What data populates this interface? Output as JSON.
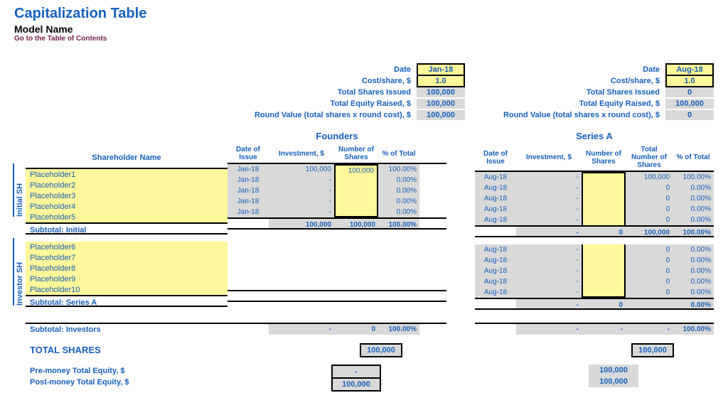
{
  "header": {
    "title": "Capitalization Table",
    "subtitle": "Model Name",
    "toc": "Go to the Table of Contents"
  },
  "summary": {
    "labels": {
      "date": "Date",
      "cost": "Cost/share, $",
      "shares": "Total Shares Issued",
      "equity": "Total Equity Raised, $",
      "roundval": "Round Value (total shares x round cost), $"
    },
    "founders": {
      "date": "Jan-18",
      "cost": "1.0",
      "shares": "100,000",
      "equity": "100,000",
      "roundval": "100,000"
    },
    "seriesA": {
      "date": "Aug-18",
      "cost": "1.0",
      "shares": "0",
      "equity": "100,000",
      "roundval": "0"
    }
  },
  "labels": {
    "shName": "Shareholder Name",
    "founders": "Founders",
    "seriesA": "Series A",
    "dateIssue": "Date of Issue",
    "investment": "Investment, $",
    "numShares": "Number of Shares",
    "totNumShares": "Total Number of Shares",
    "pctTotal": "% of Total",
    "initialSH": "Initial SH",
    "investorSH": "Investor SH",
    "subInitial": "Subtotal: Initial",
    "subSeriesA": "Subtotal: Series A",
    "subInvestors": "Subtotal: Investors",
    "totalShares": "TOTAL SHARES",
    "preMoney": "Pre-money Total Equity, $",
    "postMoney": "Post-money Total Equity, $"
  },
  "initial": [
    {
      "name": "Placeholder1",
      "f_date": "Jan-18",
      "f_inv": "100,000",
      "f_num": "100,000",
      "f_pct": "100.00%",
      "a_date": "Aug-18",
      "a_inv": "-",
      "a_num": "",
      "a_tot": "100,000",
      "a_pct": "100.00%"
    },
    {
      "name": "Placeholder2",
      "f_date": "Jan-18",
      "f_inv": "-",
      "f_num": "",
      "f_pct": "0.00%",
      "a_date": "Aug-18",
      "a_inv": "-",
      "a_num": "",
      "a_tot": "0",
      "a_pct": "0.00%"
    },
    {
      "name": "Placeholder3",
      "f_date": "Jan-18",
      "f_inv": "-",
      "f_num": "",
      "f_pct": "0.00%",
      "a_date": "Aug-18",
      "a_inv": "-",
      "a_num": "",
      "a_tot": "0",
      "a_pct": "0.00%"
    },
    {
      "name": "Placeholder4",
      "f_date": "Jan-18",
      "f_inv": "-",
      "f_num": "",
      "f_pct": "0.00%",
      "a_date": "Aug-18",
      "a_inv": "-",
      "a_num": "",
      "a_tot": "0",
      "a_pct": "0.00%"
    },
    {
      "name": "Placeholder5",
      "f_date": "Jan-18",
      "f_inv": "-",
      "f_num": "",
      "f_pct": "0.00%",
      "a_date": "Aug-18",
      "a_inv": "-",
      "a_num": "",
      "a_tot": "0",
      "a_pct": "0.00%"
    }
  ],
  "subInitial": {
    "f_inv": "100,000",
    "f_num": "100,000",
    "f_pct": "100.00%",
    "a_inv": "-",
    "a_num": "0",
    "a_tot": "100,000",
    "a_pct": "100.00%"
  },
  "investor": [
    {
      "name": "Placeholder6",
      "a_date": "Aug-18",
      "a_inv": "-",
      "a_num": "",
      "a_tot": "0",
      "a_pct": "0.00%"
    },
    {
      "name": "Placeholder7",
      "a_date": "Aug-18",
      "a_inv": "-",
      "a_num": "",
      "a_tot": "0",
      "a_pct": "0.00%"
    },
    {
      "name": "Placeholder8",
      "a_date": "Aug-18",
      "a_inv": "-",
      "a_num": "",
      "a_tot": "0",
      "a_pct": "0.00%"
    },
    {
      "name": "Placeholder9",
      "a_date": "Aug-18",
      "a_inv": "-",
      "a_num": "",
      "a_tot": "0",
      "a_pct": "0.00%"
    },
    {
      "name": "Placeholder10",
      "a_date": "Aug-18",
      "a_inv": "-",
      "a_num": "",
      "a_tot": "0",
      "a_pct": "0.00%"
    }
  ],
  "subSeriesA": {
    "a_inv": "-",
    "a_num": "0",
    "a_tot": "",
    "a_pct": "0.00%"
  },
  "subInvestors": {
    "f_inv": "-",
    "f_num": "0",
    "f_pct": "100.00%",
    "a_inv": "-",
    "a_num": "-",
    "a_tot": "-",
    "a_pct": "100.00%"
  },
  "totals": {
    "founders": {
      "shares": "100,000",
      "pre": "-",
      "post": "100,000"
    },
    "seriesA": {
      "shares": "100,000",
      "pre": "100,000",
      "post": "100,000"
    }
  }
}
